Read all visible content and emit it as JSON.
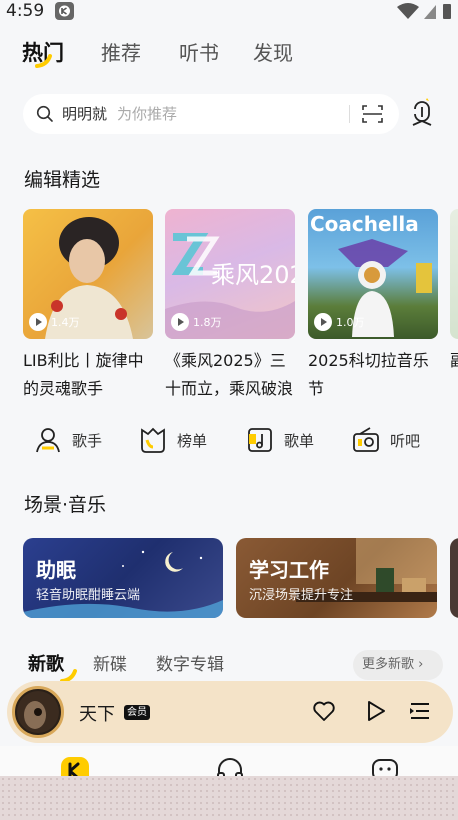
{
  "status_bar": {
    "time": "4:59"
  },
  "top_tabs": [
    "热门",
    "推荐",
    "听书",
    "发现"
  ],
  "search": {
    "keyword": "明明就",
    "hint": "为你推荐"
  },
  "editor_section": {
    "title": "编辑精选",
    "cards": [
      {
        "title": "LIB利比丨旋律中的灵魂歌手",
        "plays": "1.4万"
      },
      {
        "title": "《乘风2025》三十而立，乘风破浪",
        "plays": "1.8万",
        "cover_text": "乘风2025"
      },
      {
        "title": "2025科切拉音乐节",
        "plays": "1.0万",
        "cover_text": "Coachella"
      },
      {
        "title": "副",
        "plays": ""
      }
    ]
  },
  "quick_links": [
    {
      "label": "歌手",
      "icon": "singer-icon"
    },
    {
      "label": "榜单",
      "icon": "chart-icon"
    },
    {
      "label": "歌单",
      "icon": "playlist-icon"
    },
    {
      "label": "听吧",
      "icon": "radio-icon"
    }
  ],
  "scene_section": {
    "title": "场景·音乐",
    "cards": [
      {
        "title": "助眠",
        "subtitle": "轻音助眠酣睡云端"
      },
      {
        "title": "学习工作",
        "subtitle": "沉浸场景提升专注"
      }
    ]
  },
  "new_section": {
    "tabs": [
      "新歌",
      "新碟",
      "数字专辑"
    ],
    "more": "更多新歌"
  },
  "player": {
    "title": "天下",
    "badge": "会员"
  },
  "colors": {
    "accent": "#ffcc00",
    "player_bg": "#f4e3c8"
  }
}
